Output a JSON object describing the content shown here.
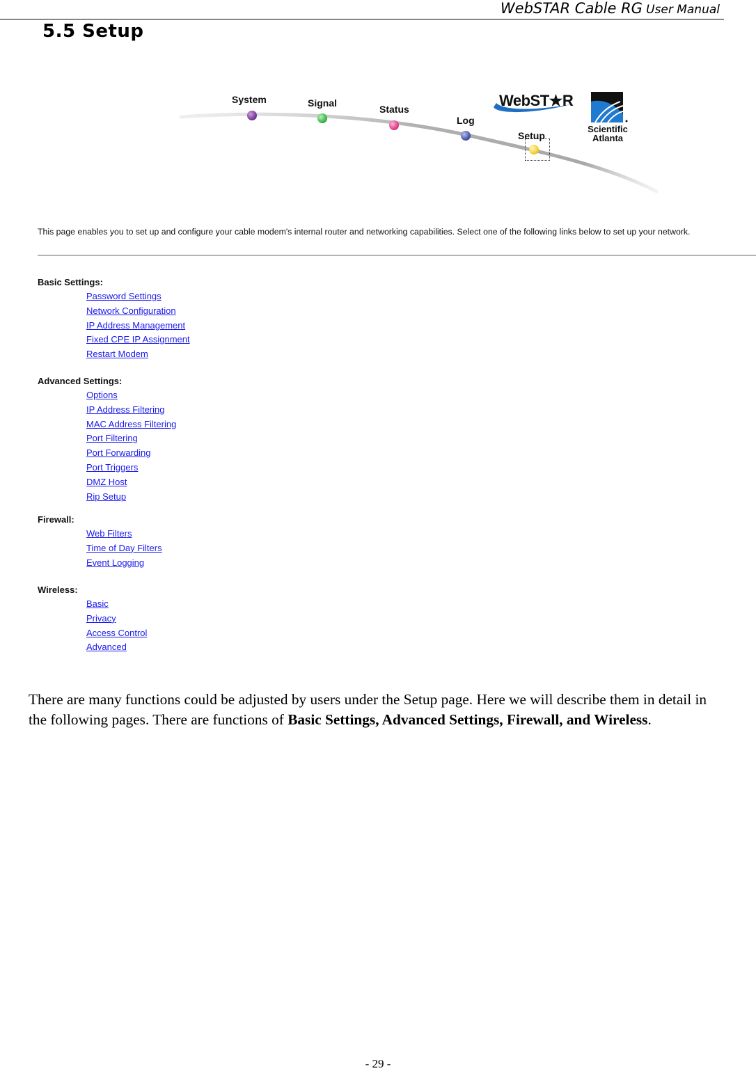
{
  "running_header": {
    "title_main": "WebSTAR Cable RG",
    "title_sub": "User Manual"
  },
  "section_heading": "5.5 Setup",
  "screenshot": {
    "nav": {
      "items": [
        {
          "label": "System",
          "color": "#7a3a96"
        },
        {
          "label": "Signal",
          "color": "#3cb84a"
        },
        {
          "label": "Status",
          "color": "#e0408c"
        },
        {
          "label": "Log",
          "color": "#4a58a8"
        },
        {
          "label": "Setup",
          "color": "#f2d230",
          "active": true
        }
      ]
    },
    "logos": {
      "webstar": "WebST★R",
      "scientific_atlanta_line1": "Scientific",
      "scientific_atlanta_line2": "Atlanta"
    },
    "intro_text": "This page enables you to set up and configure your cable modem's internal router and networking capabilities.  Select one of the following links below to set up your network.",
    "sections": [
      {
        "title": "Basic Settings:",
        "links": [
          "Password Settings",
          "Network Configuration",
          "IP Address Management",
          "Fixed CPE IP Assignment",
          "Restart Modem"
        ]
      },
      {
        "title": "Advanced Settings:",
        "links": [
          "Options",
          "IP Address Filtering",
          "MAC Address Filtering",
          "Port Filtering",
          "Port Forwarding",
          "Port Triggers",
          "DMZ Host",
          "Rip Setup"
        ]
      },
      {
        "title": "Firewall:",
        "links": [
          "Web Filters",
          "Time of Day Filters",
          "Event Logging"
        ]
      },
      {
        "title": "Wireless:",
        "links": [
          "Basic",
          "Privacy",
          "Access Control",
          "Advanced"
        ]
      }
    ],
    "link_color": "#1a1aee"
  },
  "body": {
    "text_1": "There are many functions could be adjusted by users under the Setup page. Here we will describe them in detail in the following pages. There are functions of ",
    "text_bold": "Basic Settings, Advanced Settings, Firewall, and Wireless",
    "text_end": "."
  },
  "page_number": "- 29 -"
}
